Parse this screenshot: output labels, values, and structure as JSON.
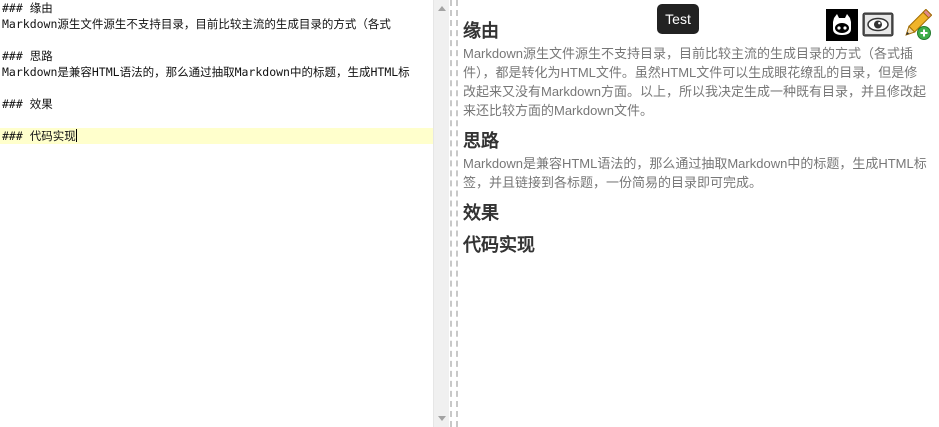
{
  "editor": {
    "lines": [
      "### 缘由",
      "Markdown源生文件源生不支持目录，目前比较主流的生成目录的方式（各式",
      "",
      "### 思路",
      "Markdown是兼容HTML语法的，那么通过抽取Markdown中的标题，生成HTML标",
      "",
      "### 效果",
      "",
      "### 代码实现"
    ]
  },
  "preview": {
    "sections": [
      {
        "heading": "缘由",
        "body": "Markdown源生文件源生不支持目录，目前比较主流的生成目录的方式（各式插件），都是转化为HTML文件。虽然HTML文件可以生成眼花缭乱的目录，但是修改起来又没有Markdown方面。以上，所以我决定生成一种既有目录，并且修改起来还比较方面的Markdown文件。"
      },
      {
        "heading": "思路",
        "body": "Markdown是兼容HTML语法的，那么通过抽取Markdown中的标题，生成HTML标签，并且链接到各标题，一份简易的目录即可完成。"
      },
      {
        "heading": "效果",
        "body": ""
      },
      {
        "heading": "代码实现",
        "body": ""
      }
    ]
  },
  "toolbar": {
    "tooltip": "Test",
    "buttons": [
      {
        "icon": "github-octocat-icon"
      },
      {
        "icon": "preview-screen-icon"
      },
      {
        "icon": "pencil-add-icon"
      }
    ]
  },
  "colors": {
    "active_line": "#ffffcc",
    "heading": "#333333",
    "body_text": "#777777",
    "tooltip_bg": "#222222"
  }
}
